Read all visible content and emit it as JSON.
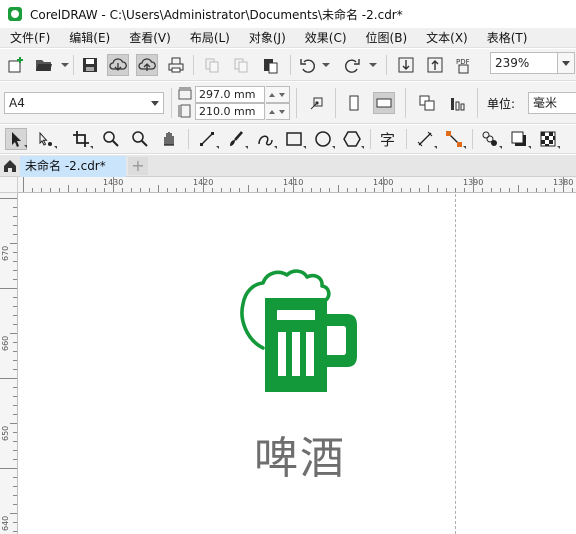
{
  "window": {
    "title": "CorelDRAW - C:\\Users\\Administrator\\Documents\\未命名 -2.cdr*"
  },
  "menu": [
    {
      "label": "文件(F)"
    },
    {
      "label": "编辑(E)"
    },
    {
      "label": "查看(V)"
    },
    {
      "label": "布局(L)"
    },
    {
      "label": "对象(J)"
    },
    {
      "label": "效果(C)"
    },
    {
      "label": "位图(B)"
    },
    {
      "label": "文本(X)"
    },
    {
      "label": "表格(T)"
    }
  ],
  "standard_toolbar": {
    "zoom_level": "239%",
    "pdf_label": "PDF"
  },
  "property_bar": {
    "page_size": "A4",
    "width": "297.0 mm",
    "height": "210.0 mm",
    "units_label": "单位:",
    "units_value": "毫米"
  },
  "document_tabs": {
    "active_tab": "未命名 -2.cdr*",
    "add_tab": "+"
  },
  "rulers": {
    "horizontal_labels": [
      "1430",
      "1420",
      "1410",
      "1400",
      "1390",
      "1380"
    ],
    "vertical_labels": [
      "670",
      "660",
      "650",
      "640"
    ]
  },
  "canvas": {
    "logo_text": "啤酒",
    "logo_color": "#14993a",
    "text_color": "#6e6e6e"
  }
}
